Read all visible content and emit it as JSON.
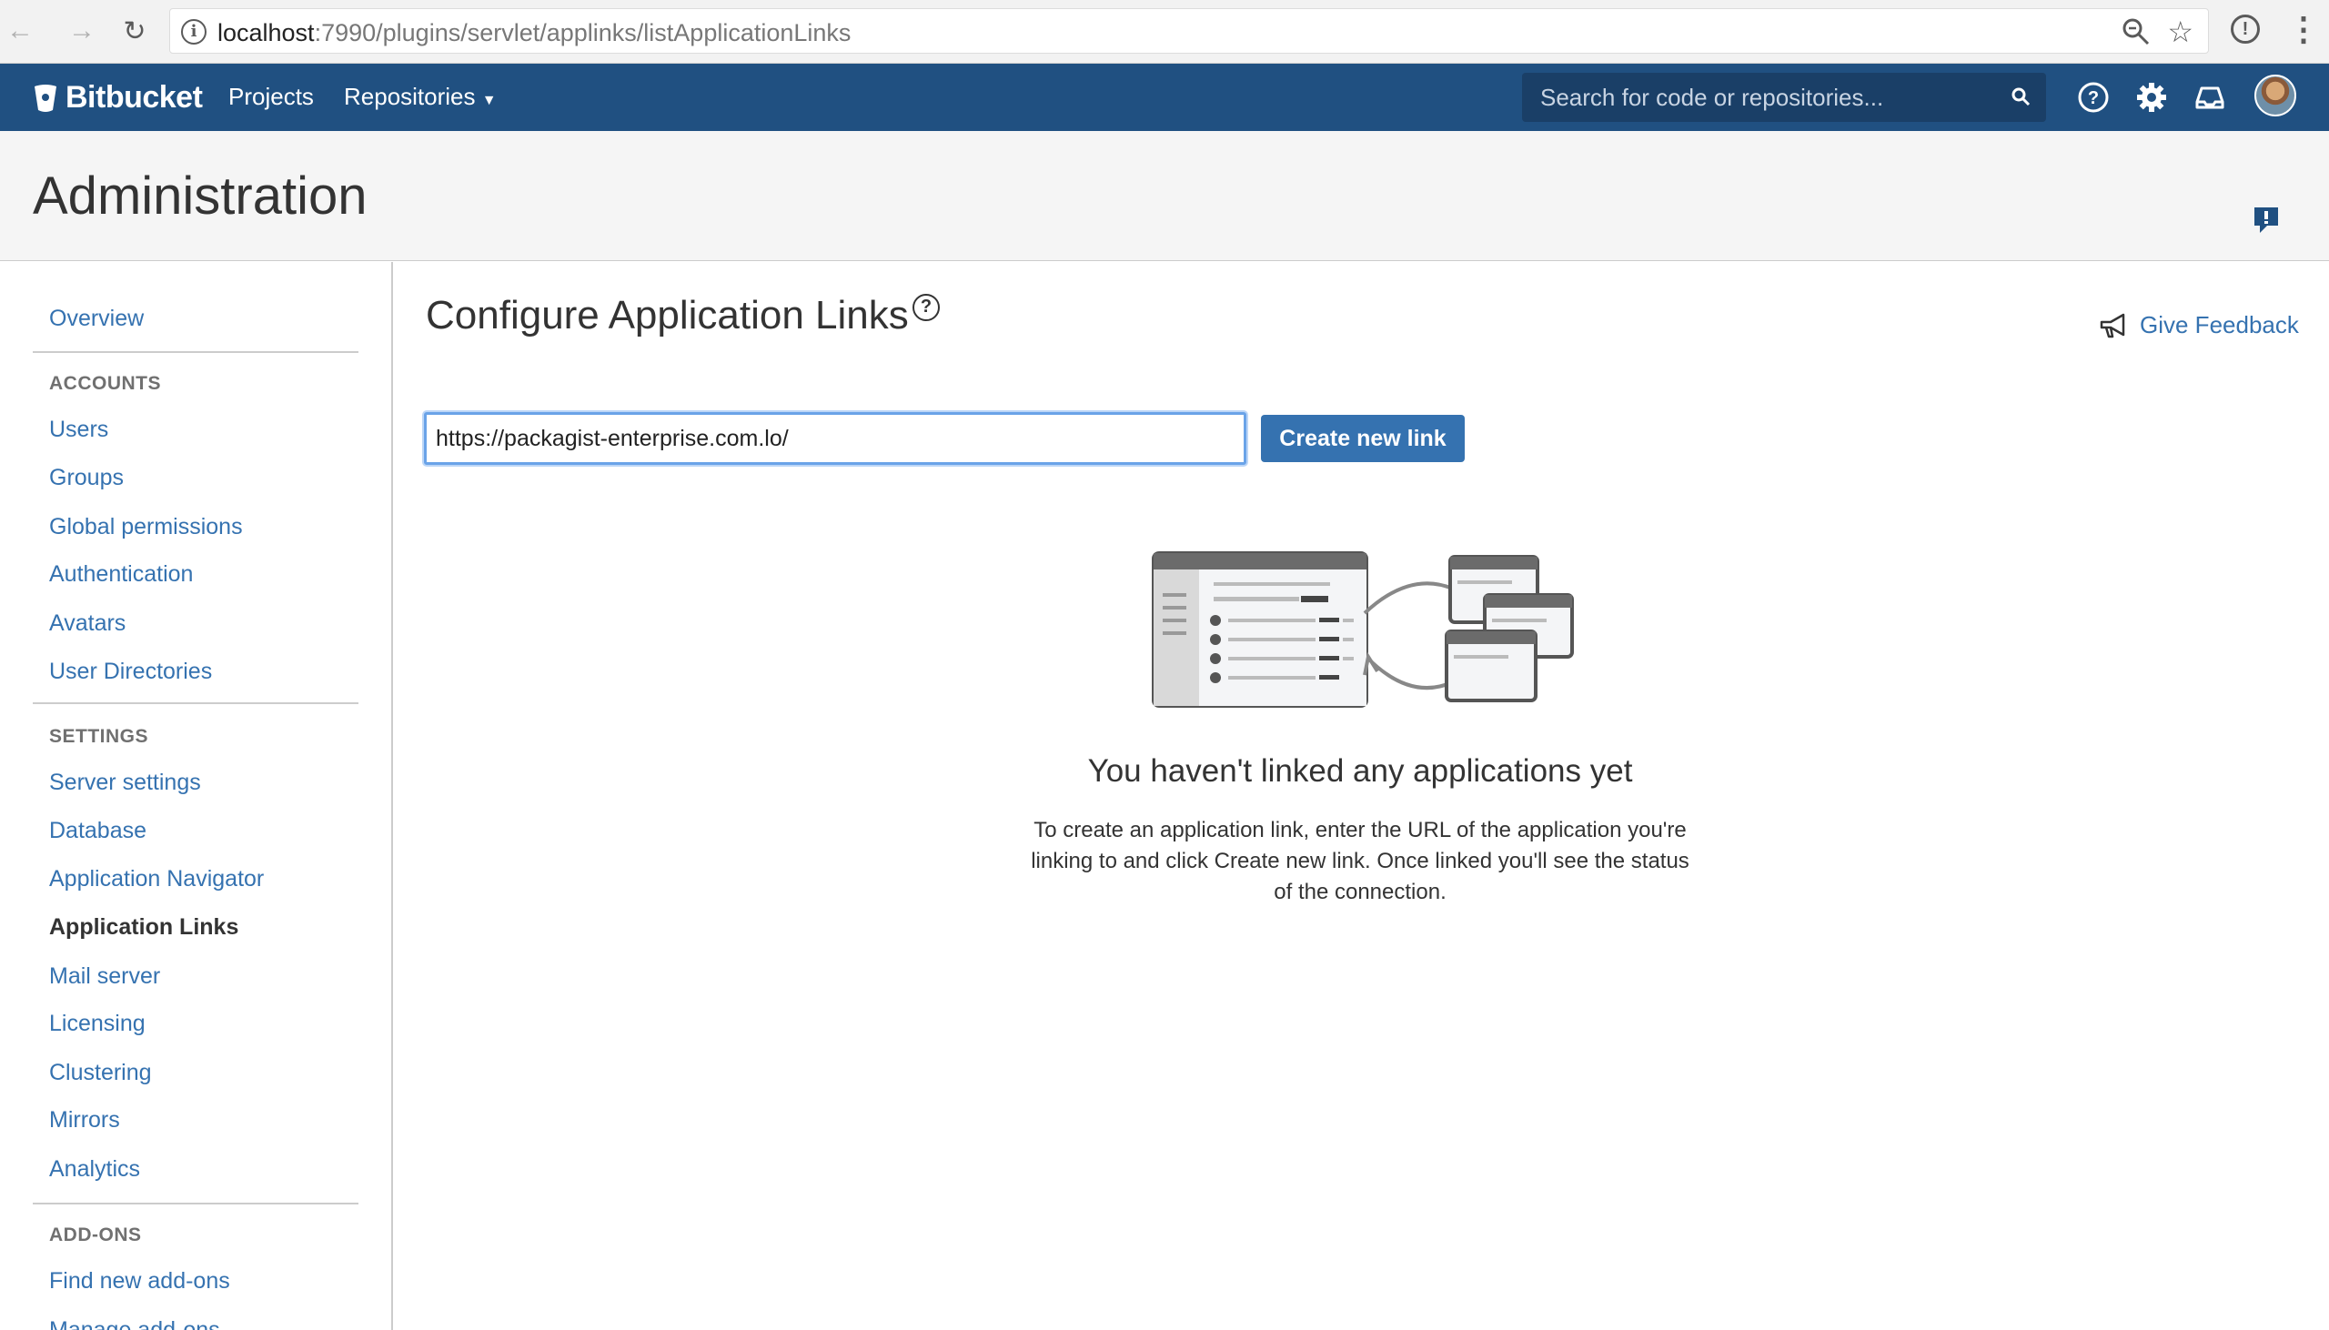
{
  "browser": {
    "url_host": "localhost",
    "url_rest": ":7990/plugins/servlet/applinks/listApplicationLinks"
  },
  "header": {
    "logo_text": "Bitbucket",
    "nav_projects": "Projects",
    "nav_repositories": "Repositories",
    "search_placeholder": "Search for code or repositories...",
    "brand_color": "#205081"
  },
  "page": {
    "title": "Administration"
  },
  "sidebar": {
    "overview": "Overview",
    "accounts_heading": "ACCOUNTS",
    "accounts": [
      "Users",
      "Groups",
      "Global permissions",
      "Authentication",
      "Avatars",
      "User Directories"
    ],
    "settings_heading": "SETTINGS",
    "settings": [
      "Server settings",
      "Database",
      "Application Navigator",
      "Application Links",
      "Mail server",
      "Licensing",
      "Clustering",
      "Mirrors",
      "Analytics"
    ],
    "addons_heading": "ADD-ONS",
    "addons": [
      "Find new add-ons",
      "Manage add-ons"
    ],
    "active_item": "Application Links"
  },
  "main": {
    "title": "Configure Application Links",
    "give_feedback": "Give Feedback",
    "url_input_value": "https://packagist-enterprise.com.lo/",
    "create_button": "Create new link",
    "empty_title": "You haven't linked any applications yet",
    "empty_desc": "To create an application link, enter the URL of the application you're linking to and click Create new link. Once linked you'll see the status of the connection."
  },
  "icons": [
    "back-arrow-icon",
    "forward-arrow-icon",
    "reload-icon",
    "info-icon",
    "zoom-icon",
    "star-icon",
    "extension-icon",
    "menu-kebab-icon",
    "bitbucket-logo-icon",
    "caret-down-icon",
    "search-icon",
    "help-icon",
    "gear-icon",
    "inbox-icon",
    "feedback-flag-icon",
    "megaphone-icon"
  ]
}
